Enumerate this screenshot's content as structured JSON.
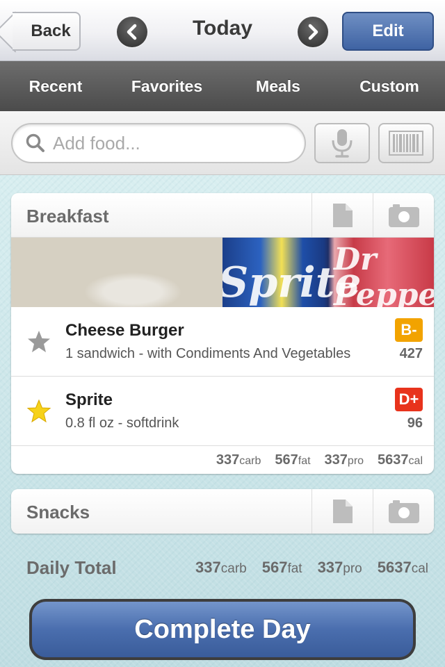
{
  "header": {
    "back_label": "Back",
    "title": "Today",
    "edit_label": "Edit",
    "prev_icon": "chevron-left-icon",
    "next_icon": "chevron-right-icon"
  },
  "tabs": [
    {
      "label": "Recent"
    },
    {
      "label": "Favorites"
    },
    {
      "label": "Meals"
    },
    {
      "label": "Custom"
    }
  ],
  "search": {
    "placeholder": "Add food...",
    "value": ""
  },
  "breakfast": {
    "title": "Breakfast",
    "photo_text": [
      "Sprite",
      "Dr Pepper"
    ],
    "items": [
      {
        "name": "Cheese Burger",
        "description": "1 sandwich - with Condiments And Vegetables",
        "grade": "B-",
        "grade_color": "#f2a300",
        "calories": "427",
        "favorite": false
      },
      {
        "name": "Sprite",
        "description": "0.8 fl oz - softdrink",
        "grade": "D+",
        "grade_color": "#e8331c",
        "calories": "96",
        "favorite": true
      }
    ],
    "totals": {
      "carb": "337",
      "carb_unit": "carb",
      "fat": "567",
      "fat_unit": "fat",
      "pro": "337",
      "pro_unit": "pro",
      "cal": "5637",
      "cal_unit": "cal"
    }
  },
  "snacks": {
    "title": "Snacks"
  },
  "daily_total": {
    "label": "Daily Total",
    "carb": "337",
    "carb_unit": "carb",
    "fat": "567",
    "fat_unit": "fat",
    "pro": "337",
    "pro_unit": "pro",
    "cal": "5637",
    "cal_unit": "cal"
  },
  "complete_label": "Complete Day",
  "colors": {
    "accent_blue": "#4a6eae",
    "tab_bar": "#5a5a5a",
    "star_active": "#f6d21a",
    "star_inactive": "#9a9a9a"
  }
}
